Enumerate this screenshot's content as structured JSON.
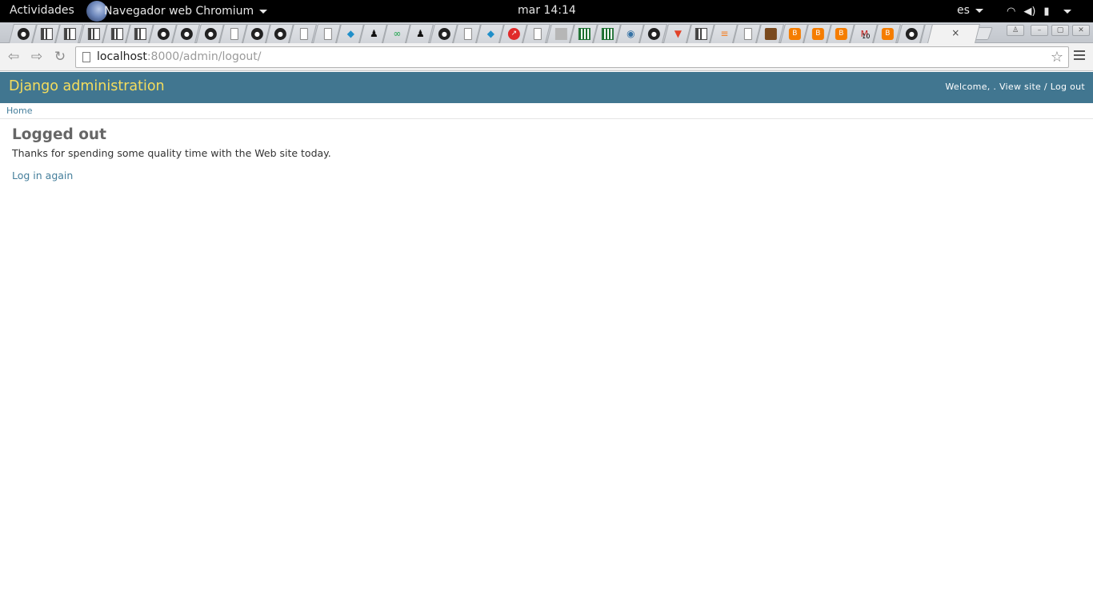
{
  "topbar": {
    "activities": "Actividades",
    "app_name": "Navegador web Chromium",
    "clock": "mar 14:14",
    "lang": "es"
  },
  "tabs": [
    {
      "icon": "github-icon",
      "glyph": "●",
      "kind": "gh"
    },
    {
      "icon": "panel-icon",
      "glyph": "",
      "kind": "panel"
    },
    {
      "icon": "panel-icon",
      "glyph": "",
      "kind": "panel"
    },
    {
      "icon": "panel-icon",
      "glyph": "",
      "kind": "panel"
    },
    {
      "icon": "panel-icon",
      "glyph": "",
      "kind": "panel"
    },
    {
      "icon": "panel-icon",
      "glyph": "",
      "kind": "panel"
    },
    {
      "icon": "github-icon",
      "glyph": "●",
      "kind": "gh"
    },
    {
      "icon": "github-icon",
      "glyph": "●",
      "kind": "gh"
    },
    {
      "icon": "github-icon",
      "glyph": "●",
      "kind": "gh"
    },
    {
      "icon": "page-icon",
      "glyph": "",
      "kind": "doc"
    },
    {
      "icon": "github-icon",
      "glyph": "●",
      "kind": "gh"
    },
    {
      "icon": "github-icon",
      "glyph": "●",
      "kind": "gh"
    },
    {
      "icon": "page-icon",
      "glyph": "",
      "kind": "doc"
    },
    {
      "icon": "page-icon",
      "glyph": "",
      "kind": "doc"
    },
    {
      "icon": "docker-icon",
      "glyph": "◆",
      "kind": "docker"
    },
    {
      "icon": "tux-icon",
      "glyph": "♟",
      "kind": "tux"
    },
    {
      "icon": "infinity-icon",
      "glyph": "∞",
      "kind": "green"
    },
    {
      "icon": "penguin-icon",
      "glyph": "♟",
      "kind": "tux"
    },
    {
      "icon": "github-icon",
      "glyph": "●",
      "kind": "gh"
    },
    {
      "icon": "page-icon",
      "glyph": "",
      "kind": "doc"
    },
    {
      "icon": "docker-icon",
      "glyph": "◆",
      "kind": "docker"
    },
    {
      "icon": "trend-icon",
      "glyph": "↗",
      "kind": "red"
    },
    {
      "icon": "page-icon",
      "glyph": "",
      "kind": "doc"
    },
    {
      "icon": "image-icon",
      "glyph": "",
      "kind": "grey"
    },
    {
      "icon": "grid-icon",
      "glyph": "",
      "kind": "grid"
    },
    {
      "icon": "grid-icon",
      "glyph": "",
      "kind": "grid"
    },
    {
      "icon": "python-icon",
      "glyph": "◉",
      "kind": "py"
    },
    {
      "icon": "github-icon",
      "glyph": "●",
      "kind": "gh"
    },
    {
      "icon": "gitlab-icon",
      "glyph": "▼",
      "kind": "gitlab"
    },
    {
      "icon": "panel-icon",
      "glyph": "",
      "kind": "panel"
    },
    {
      "icon": "stackoverflow-icon",
      "glyph": "≡",
      "kind": "so"
    },
    {
      "icon": "page-icon",
      "glyph": "",
      "kind": "doc"
    },
    {
      "icon": "image-icon",
      "glyph": "",
      "kind": "img"
    },
    {
      "icon": "blogger-icon",
      "glyph": "B",
      "kind": "blog"
    },
    {
      "icon": "blogger-icon",
      "glyph": "B",
      "kind": "blog"
    },
    {
      "icon": "blogger-icon",
      "glyph": "B",
      "kind": "blog"
    },
    {
      "icon": "gmail-icon",
      "glyph": "M",
      "kind": "gmail"
    },
    {
      "icon": "blogger-icon",
      "glyph": "B",
      "kind": "blog"
    },
    {
      "icon": "github-icon",
      "glyph": "●",
      "kind": "gh"
    },
    {
      "icon": "tux-icon",
      "glyph": "♟",
      "kind": "tux"
    }
  ],
  "gmail_badge": "10",
  "active_tab": {
    "close_glyph": "×"
  },
  "omnibox": {
    "host": "localhost",
    "rest": ":8000/admin/logout/"
  },
  "admin": {
    "branding": "Django administration",
    "welcome": "Welcome, .",
    "view_site": "View site",
    "separator": " / ",
    "log_out": "Log out",
    "breadcrumb_home": "Home",
    "title": "Logged out",
    "message": "Thanks for spending some quality time with the Web site today.",
    "log_in_again": "Log in again"
  },
  "colors": {
    "header_bg": "#417690",
    "branding": "#f5dd5d",
    "link": "#447e9b"
  }
}
